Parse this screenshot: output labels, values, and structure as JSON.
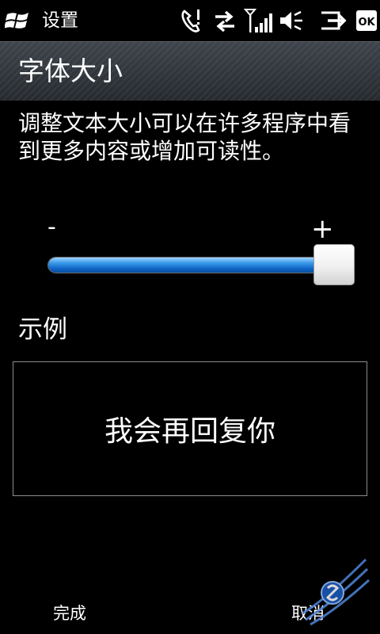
{
  "status_bar": {
    "app_title": "设置",
    "icons": [
      "windows-start-icon",
      "phone-call-icon",
      "data-transfer-icon",
      "signal-strength-icon",
      "volume-muted-icon",
      "connection-icon",
      "ok-icon"
    ],
    "ok_label": "OK"
  },
  "header": {
    "title": "字体大小"
  },
  "description": "调整文本大小可以在许多程序中看到更多内容或增加可读性。",
  "slider": {
    "min_label": "-",
    "max_label": "+",
    "level": 1.0
  },
  "sample": {
    "label": "示例",
    "text": "我会再回复你"
  },
  "softkeys": {
    "left": "完成",
    "right": "取消"
  },
  "colors": {
    "background": "#000000",
    "accent": "#1f7fe0"
  }
}
